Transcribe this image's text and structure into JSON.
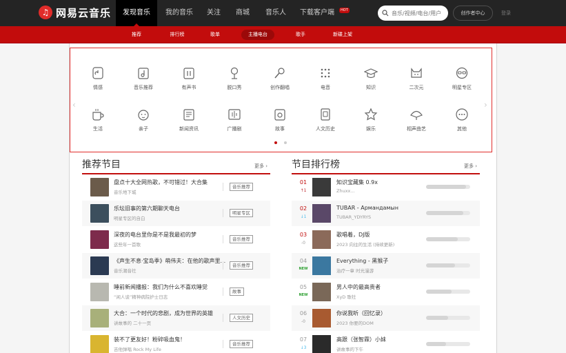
{
  "app": {
    "logo_text": "网易云音乐"
  },
  "topnav": {
    "items": [
      "发现音乐",
      "我的音乐",
      "关注",
      "商城",
      "音乐人",
      "下载客户端"
    ],
    "hot_badge": "HOT",
    "search_placeholder": "音乐/视频/电台/用户",
    "creator_label": "创作者中心",
    "login_label": "登录"
  },
  "subnav": {
    "items": [
      "推荐",
      "排行榜",
      "歌单",
      "主播电台",
      "歌手",
      "新碟上架"
    ],
    "active_index": 3
  },
  "categories": [
    {
      "label": "情感",
      "icon": "heart-note-icon"
    },
    {
      "label": "音乐推荐",
      "icon": "music-note-icon"
    },
    {
      "label": "有声书",
      "icon": "book-icon"
    },
    {
      "label": "脱口秀",
      "icon": "microphone-stand-icon"
    },
    {
      "label": "创作翻唱",
      "icon": "microphone-icon"
    },
    {
      "label": "电音",
      "icon": "dots-grid-icon"
    },
    {
      "label": "知识",
      "icon": "graduation-cap-icon"
    },
    {
      "label": "二次元",
      "icon": "cat-icon"
    },
    {
      "label": "明星专区",
      "icon": "star-glasses-icon"
    },
    {
      "label": "生活",
      "icon": "cup-icon"
    },
    {
      "label": "亲子",
      "icon": "baby-face-icon"
    },
    {
      "label": "新闻资讯",
      "icon": "news-icon"
    },
    {
      "label": "广播剧",
      "icon": "film-icon"
    },
    {
      "label": "故事",
      "icon": "story-icon"
    },
    {
      "label": "人文历史",
      "icon": "history-icon"
    },
    {
      "label": "娱乐",
      "icon": "star-icon"
    },
    {
      "label": "相声曲艺",
      "icon": "fan-icon"
    },
    {
      "label": "其他",
      "icon": "more-icon"
    }
  ],
  "recommend": {
    "title": "推荐节目",
    "more": "更多",
    "items": [
      {
        "title": "盘点十大全网热歌，不可错过！大合集",
        "sub": "音乐地下城",
        "tag": "音乐推荐"
      },
      {
        "title": "乐坛旧事的第六期聊天电台",
        "sub": "明星专区的自白",
        "tag": "明星专区"
      },
      {
        "title": "深夜的电台里你是不是我最初的梦",
        "sub": "这些年一首歌",
        "tag": "音乐推荐"
      },
      {
        "title": "《声生不息·宝岛季》萌伟夫：在他的歌声里...",
        "sub": "音乐潮音社",
        "tag": "音乐推荐"
      },
      {
        "title": "睡前新闻播报：我们为什么不喜欢睡觉",
        "sub": "“闲人谈”精神病院护士日志",
        "tag": "故事"
      },
      {
        "title": "大合：一个时代的悲剧，成为世界的英雄",
        "sub": "讲故事的 二十一页",
        "tag": "人文历史"
      },
      {
        "title": "装不了更友好！粉碎吸血鬼！",
        "sub": "吉他弹唱 Rock My Life",
        "tag": "音乐推荐"
      }
    ]
  },
  "ranking": {
    "title": "节目排行榜",
    "more": "更多",
    "items": [
      {
        "rank": "01",
        "delta": "↑1",
        "delta_type": "up",
        "title": "知识宝藏集 0.9x",
        "sub": "Zhuxx...",
        "progress": 0.9
      },
      {
        "rank": "02",
        "delta": "↓1",
        "delta_type": "down",
        "title": "TUBAR - Армандамын",
        "sub": "TUBAR_YDYRYS",
        "progress": 0.85
      },
      {
        "rank": "03",
        "delta": "-0",
        "delta_type": "same",
        "title": "歌唱着，DJ版",
        "sub": "2023 向往的生活 (持续更新)",
        "progress": 0.72
      },
      {
        "rank": "04",
        "delta": "NEW",
        "delta_type": "new",
        "title": "Everything - 黑猴子",
        "sub": "治疗一章 时光漫游",
        "progress": 0.65
      },
      {
        "rank": "05",
        "delta": "NEW",
        "delta_type": "new",
        "title": "男人中的最高贵者",
        "sub": "XyD 歌社",
        "progress": 0.58
      },
      {
        "rank": "06",
        "delta": "-0",
        "delta_type": "same",
        "title": "你说我听（回忆录）",
        "sub": "2023 你要的DOM",
        "progress": 0.5
      },
      {
        "rank": "07",
        "delta": "↓3",
        "delta_type": "down",
        "title": "高跟（张智霖）小妹",
        "sub": "讲故事的下午",
        "progress": 0.45
      }
    ]
  },
  "colors": {
    "brand_red": "#c20c0c",
    "topbar": "#242424",
    "highlight_border": "#e02c2a"
  }
}
